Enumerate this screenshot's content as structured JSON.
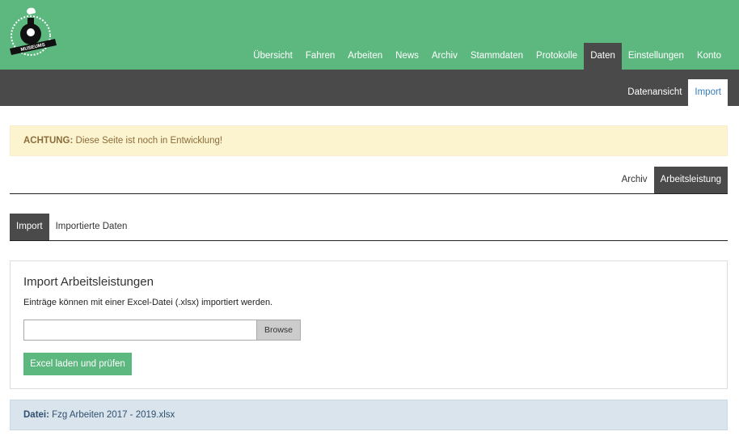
{
  "header": {
    "nav": [
      "Übersicht",
      "Fahren",
      "Arbeiten",
      "News",
      "Archiv",
      "Stammdaten",
      "Protokolle",
      "Daten",
      "Einstellungen",
      "Konto"
    ],
    "active_nav": "Daten"
  },
  "subnav": {
    "items": [
      "Datenansicht",
      "Import"
    ],
    "active": "Import"
  },
  "alert": {
    "strong": "ACHTUNG:",
    "text": " Diese Seite ist noch in Entwicklung!"
  },
  "right_tabs": {
    "items": [
      "Archiv",
      "Arbeitsleistung"
    ]
  },
  "left_tabs": {
    "items": [
      "Import",
      "Importierte Daten"
    ]
  },
  "panel": {
    "title": "Import Arbeitsleistungen",
    "text": "Einträge können mit einer Excel-Datei (.xlsx) importiert werden.",
    "file_value": "",
    "browse": "Browse",
    "submit": "Excel laden und prüfen"
  },
  "file_info": {
    "label": "Datei:",
    "name": " Fzg Arbeiten 2017 - 2019.xlsx"
  },
  "colors": {
    "brand": "#5db87f",
    "dark": "#4a4a4a"
  }
}
